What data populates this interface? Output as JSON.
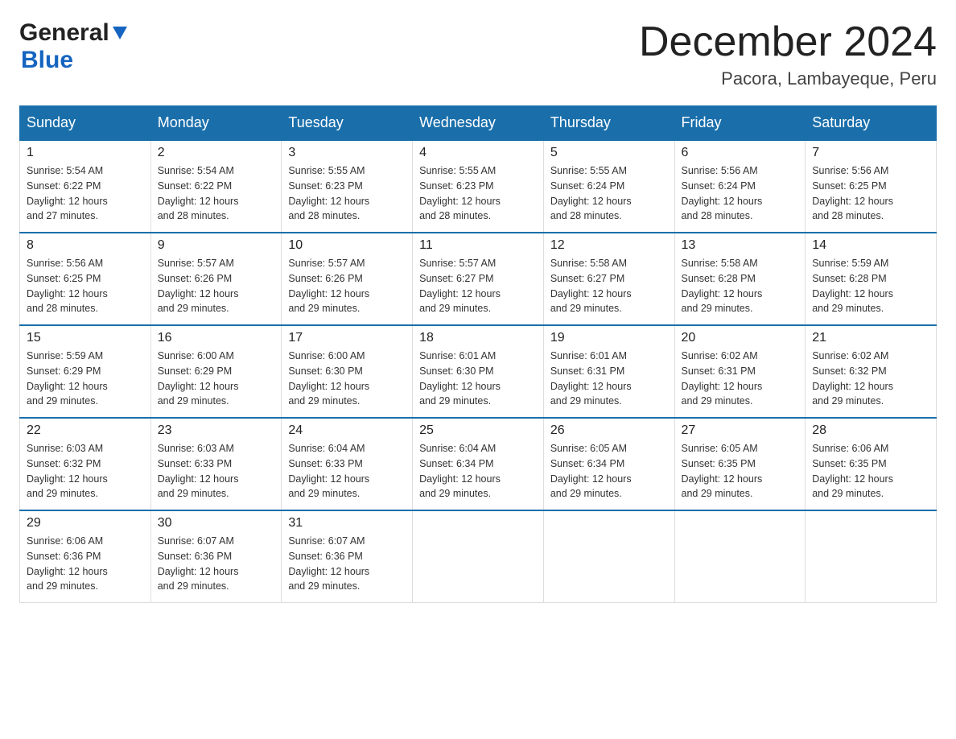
{
  "logo": {
    "text_general": "General",
    "text_blue": "Blue"
  },
  "title": "December 2024",
  "location": "Pacora, Lambayeque, Peru",
  "days_of_week": [
    "Sunday",
    "Monday",
    "Tuesday",
    "Wednesday",
    "Thursday",
    "Friday",
    "Saturday"
  ],
  "weeks": [
    [
      {
        "day": "1",
        "sunrise": "5:54 AM",
        "sunset": "6:22 PM",
        "daylight": "12 hours and 27 minutes."
      },
      {
        "day": "2",
        "sunrise": "5:54 AM",
        "sunset": "6:22 PM",
        "daylight": "12 hours and 28 minutes."
      },
      {
        "day": "3",
        "sunrise": "5:55 AM",
        "sunset": "6:23 PM",
        "daylight": "12 hours and 28 minutes."
      },
      {
        "day": "4",
        "sunrise": "5:55 AM",
        "sunset": "6:23 PM",
        "daylight": "12 hours and 28 minutes."
      },
      {
        "day": "5",
        "sunrise": "5:55 AM",
        "sunset": "6:24 PM",
        "daylight": "12 hours and 28 minutes."
      },
      {
        "day": "6",
        "sunrise": "5:56 AM",
        "sunset": "6:24 PM",
        "daylight": "12 hours and 28 minutes."
      },
      {
        "day": "7",
        "sunrise": "5:56 AM",
        "sunset": "6:25 PM",
        "daylight": "12 hours and 28 minutes."
      }
    ],
    [
      {
        "day": "8",
        "sunrise": "5:56 AM",
        "sunset": "6:25 PM",
        "daylight": "12 hours and 28 minutes."
      },
      {
        "day": "9",
        "sunrise": "5:57 AM",
        "sunset": "6:26 PM",
        "daylight": "12 hours and 29 minutes."
      },
      {
        "day": "10",
        "sunrise": "5:57 AM",
        "sunset": "6:26 PM",
        "daylight": "12 hours and 29 minutes."
      },
      {
        "day": "11",
        "sunrise": "5:57 AM",
        "sunset": "6:27 PM",
        "daylight": "12 hours and 29 minutes."
      },
      {
        "day": "12",
        "sunrise": "5:58 AM",
        "sunset": "6:27 PM",
        "daylight": "12 hours and 29 minutes."
      },
      {
        "day": "13",
        "sunrise": "5:58 AM",
        "sunset": "6:28 PM",
        "daylight": "12 hours and 29 minutes."
      },
      {
        "day": "14",
        "sunrise": "5:59 AM",
        "sunset": "6:28 PM",
        "daylight": "12 hours and 29 minutes."
      }
    ],
    [
      {
        "day": "15",
        "sunrise": "5:59 AM",
        "sunset": "6:29 PM",
        "daylight": "12 hours and 29 minutes."
      },
      {
        "day": "16",
        "sunrise": "6:00 AM",
        "sunset": "6:29 PM",
        "daylight": "12 hours and 29 minutes."
      },
      {
        "day": "17",
        "sunrise": "6:00 AM",
        "sunset": "6:30 PM",
        "daylight": "12 hours and 29 minutes."
      },
      {
        "day": "18",
        "sunrise": "6:01 AM",
        "sunset": "6:30 PM",
        "daylight": "12 hours and 29 minutes."
      },
      {
        "day": "19",
        "sunrise": "6:01 AM",
        "sunset": "6:31 PM",
        "daylight": "12 hours and 29 minutes."
      },
      {
        "day": "20",
        "sunrise": "6:02 AM",
        "sunset": "6:31 PM",
        "daylight": "12 hours and 29 minutes."
      },
      {
        "day": "21",
        "sunrise": "6:02 AM",
        "sunset": "6:32 PM",
        "daylight": "12 hours and 29 minutes."
      }
    ],
    [
      {
        "day": "22",
        "sunrise": "6:03 AM",
        "sunset": "6:32 PM",
        "daylight": "12 hours and 29 minutes."
      },
      {
        "day": "23",
        "sunrise": "6:03 AM",
        "sunset": "6:33 PM",
        "daylight": "12 hours and 29 minutes."
      },
      {
        "day": "24",
        "sunrise": "6:04 AM",
        "sunset": "6:33 PM",
        "daylight": "12 hours and 29 minutes."
      },
      {
        "day": "25",
        "sunrise": "6:04 AM",
        "sunset": "6:34 PM",
        "daylight": "12 hours and 29 minutes."
      },
      {
        "day": "26",
        "sunrise": "6:05 AM",
        "sunset": "6:34 PM",
        "daylight": "12 hours and 29 minutes."
      },
      {
        "day": "27",
        "sunrise": "6:05 AM",
        "sunset": "6:35 PM",
        "daylight": "12 hours and 29 minutes."
      },
      {
        "day": "28",
        "sunrise": "6:06 AM",
        "sunset": "6:35 PM",
        "daylight": "12 hours and 29 minutes."
      }
    ],
    [
      {
        "day": "29",
        "sunrise": "6:06 AM",
        "sunset": "6:36 PM",
        "daylight": "12 hours and 29 minutes."
      },
      {
        "day": "30",
        "sunrise": "6:07 AM",
        "sunset": "6:36 PM",
        "daylight": "12 hours and 29 minutes."
      },
      {
        "day": "31",
        "sunrise": "6:07 AM",
        "sunset": "6:36 PM",
        "daylight": "12 hours and 29 minutes."
      },
      null,
      null,
      null,
      null
    ]
  ],
  "labels": {
    "sunrise": "Sunrise:",
    "sunset": "Sunset:",
    "daylight": "Daylight:"
  }
}
